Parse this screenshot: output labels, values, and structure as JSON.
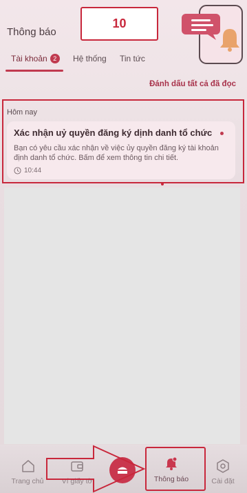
{
  "header": {
    "title": "Thông báo",
    "step_number": "10"
  },
  "tabs": [
    {
      "label": "Tài khoản",
      "badge": "2",
      "active": true
    },
    {
      "label": "Hệ thống",
      "active": false
    },
    {
      "label": "Tin tức",
      "active": false
    }
  ],
  "actions": {
    "mark_all_read": "Đánh dấu tất cả đã đọc"
  },
  "notifications": {
    "section_label": "Hôm nay",
    "items": [
      {
        "title": "Xác nhận uỷ quyền đăng ký dịnh danh tổ chức",
        "body": "Bạn có yêu cầu xác nhận về việc ủy quyền đăng ký tài khoản định danh tổ chức. Bấm để xem thông tin chi tiết.",
        "time": "10:44",
        "unread": true
      }
    ]
  },
  "bottom_nav": {
    "items": [
      {
        "label": "Trang chủ",
        "icon": "home-icon"
      },
      {
        "label": "Ví giấy tờ",
        "icon": "wallet-icon"
      },
      {
        "label": "",
        "icon": "scan-icon"
      },
      {
        "label": "Thông báo",
        "icon": "bell-icon",
        "active": true
      },
      {
        "label": "Cài đặt",
        "icon": "gear-icon"
      }
    ]
  },
  "colors": {
    "accent": "#c03a4f",
    "annotation": "#c8273b",
    "background": "#efe4e7"
  }
}
